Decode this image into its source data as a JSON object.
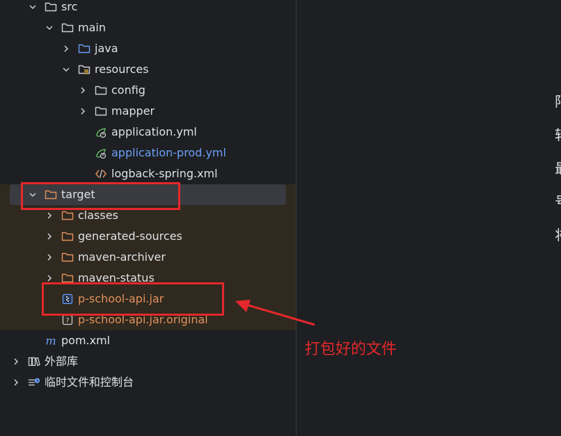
{
  "tree": {
    "items": [
      {
        "label": "src",
        "depth": 1,
        "expanded": true,
        "icon": "folder-icon",
        "color": "default"
      },
      {
        "label": "main",
        "depth": 2,
        "expanded": true,
        "icon": "folder-icon",
        "color": "default"
      },
      {
        "label": "java",
        "depth": 3,
        "expanded": false,
        "icon": "source-folder-icon",
        "color": "default"
      },
      {
        "label": "resources",
        "depth": 3,
        "expanded": true,
        "icon": "resources-folder-icon",
        "color": "default"
      },
      {
        "label": "config",
        "depth": 4,
        "expanded": false,
        "icon": "folder-icon",
        "color": "default"
      },
      {
        "label": "mapper",
        "depth": 4,
        "expanded": false,
        "icon": "folder-icon",
        "color": "default"
      },
      {
        "label": "application.yml",
        "depth": 4,
        "leaf": true,
        "icon": "spring-yaml-icon",
        "color": "default"
      },
      {
        "label": "application-prod.yml",
        "depth": 4,
        "leaf": true,
        "icon": "spring-yaml-icon",
        "color": "blue"
      },
      {
        "label": "logback-spring.xml",
        "depth": 4,
        "leaf": true,
        "icon": "xml-file-icon",
        "color": "default"
      },
      {
        "label": "target",
        "depth": 1,
        "expanded": true,
        "icon": "excluded-folder-icon",
        "color": "default",
        "selected": true
      },
      {
        "label": "classes",
        "depth": 2,
        "expanded": false,
        "icon": "excluded-folder-icon",
        "color": "default"
      },
      {
        "label": "generated-sources",
        "depth": 2,
        "expanded": false,
        "icon": "excluded-folder-icon",
        "color": "default"
      },
      {
        "label": "maven-archiver",
        "depth": 2,
        "expanded": false,
        "icon": "excluded-folder-icon",
        "color": "default"
      },
      {
        "label": "maven-status",
        "depth": 2,
        "expanded": false,
        "icon": "excluded-folder-icon",
        "color": "default"
      },
      {
        "label": "p-school-api.jar",
        "depth": 2,
        "leaf": true,
        "icon": "jar-file-icon",
        "color": "orange"
      },
      {
        "label": "p-school-api.jar.original",
        "depth": 2,
        "leaf": true,
        "icon": "unknown-file-icon",
        "color": "orange"
      },
      {
        "label": "pom.xml",
        "depth": 1,
        "leaf": true,
        "icon": "maven-icon",
        "color": "default"
      },
      {
        "label": "外部库",
        "depth": 0,
        "expanded": false,
        "icon": "library-icon",
        "color": "default"
      },
      {
        "label": "临时文件和控制台",
        "depth": 0,
        "expanded": false,
        "icon": "scratches-icon",
        "color": "default"
      }
    ]
  },
  "annotation": {
    "label": "打包好的文件",
    "color": "#e5282b"
  },
  "right_edge_glyphs": [
    "阳",
    "转",
    "最",
    "号",
    "将"
  ],
  "colors": {
    "background": "#1e1f22",
    "target_highlight": "#2f291f",
    "selection": "#393b40",
    "blue_text": "#6aa0f8",
    "orange_text": "#e3915b",
    "annotation_red": "#e5282b"
  }
}
